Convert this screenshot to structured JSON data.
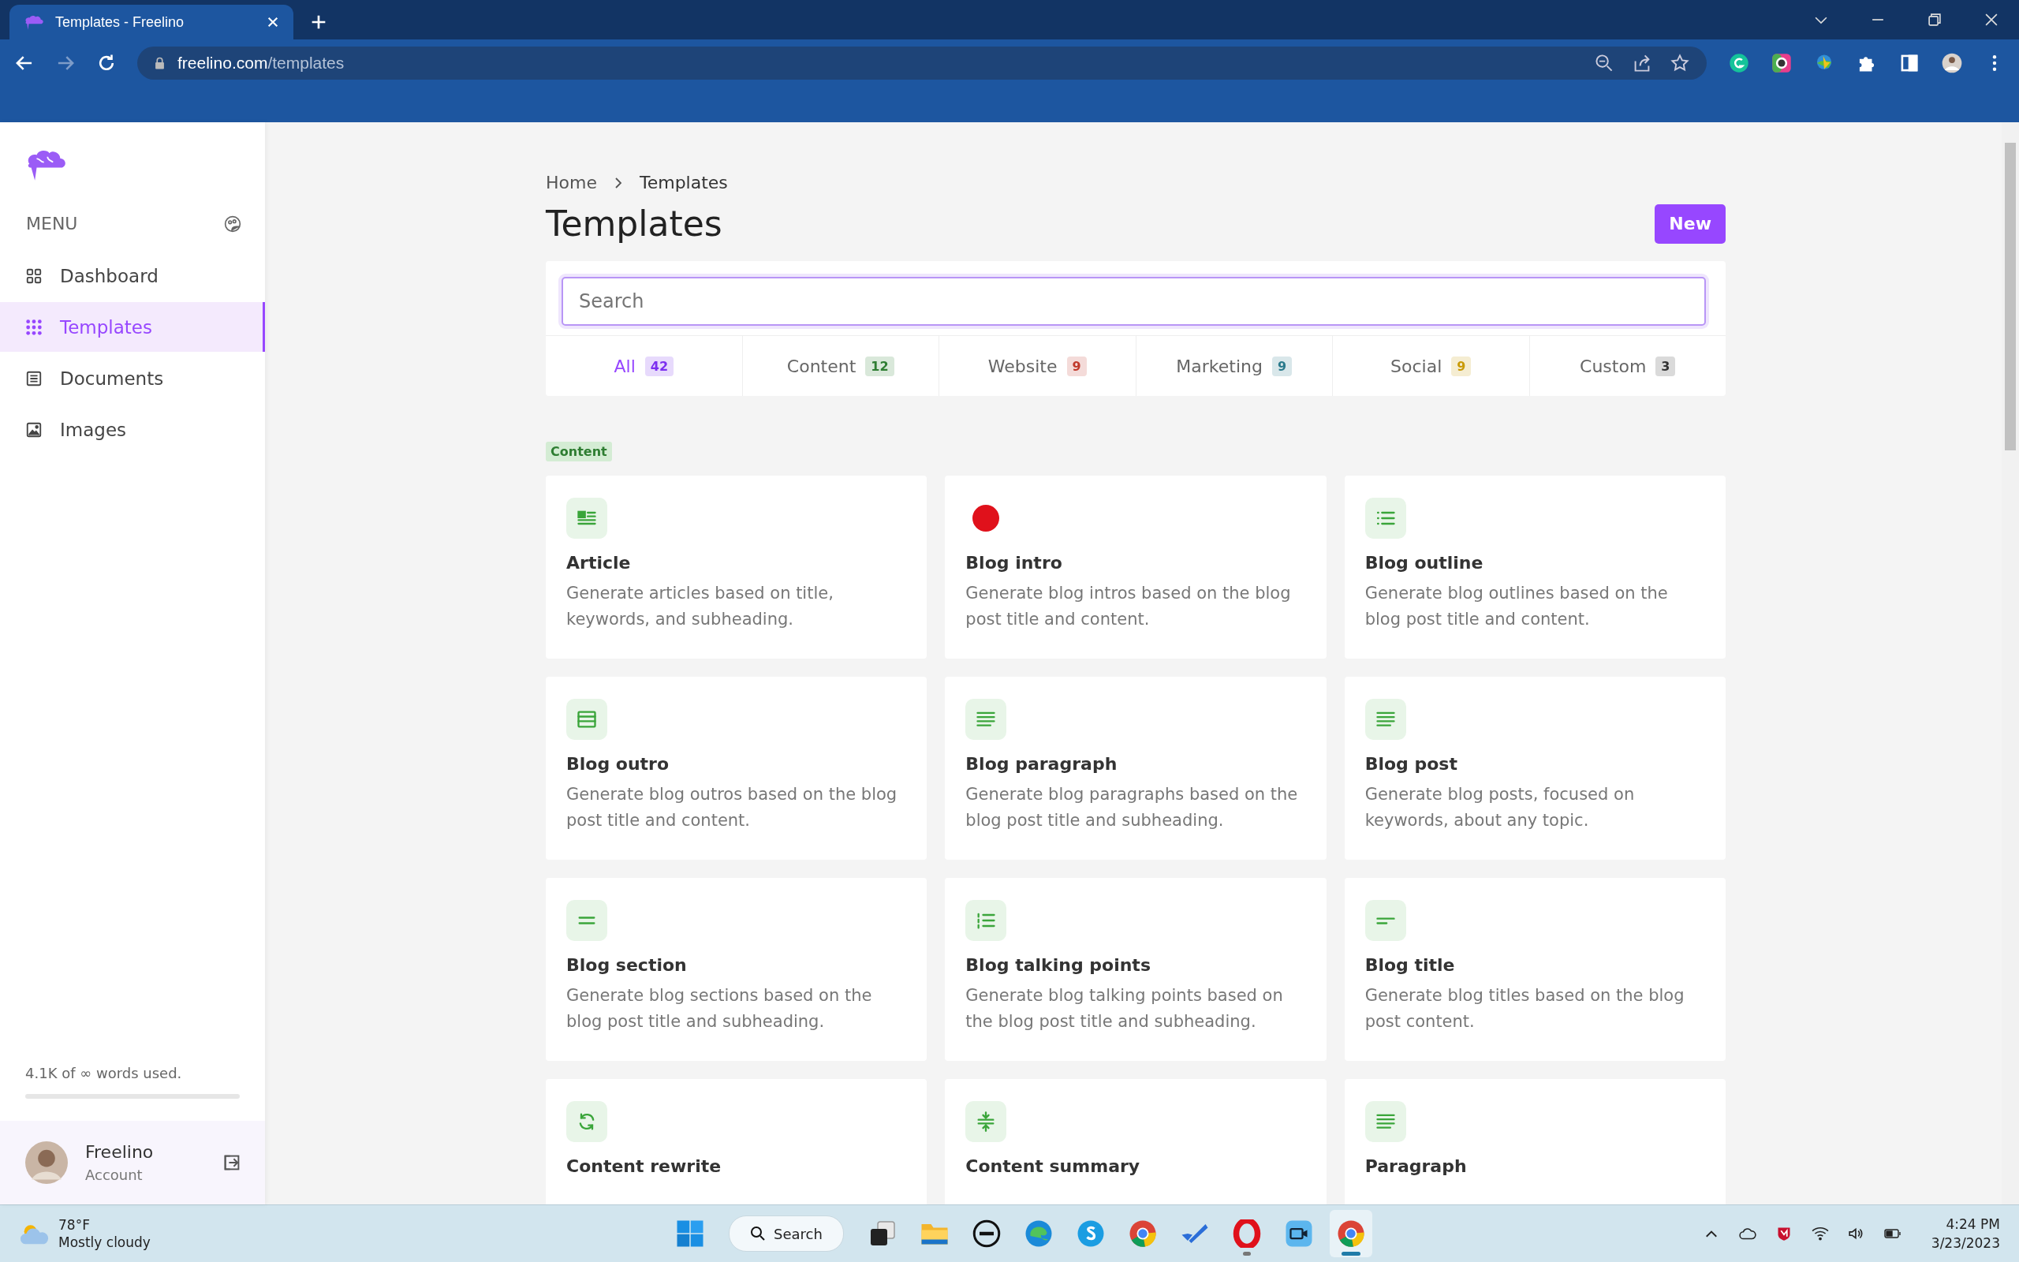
{
  "browser": {
    "tab_title": "Templates - Freelino",
    "url_domain": "freelino.com",
    "url_path": "/templates"
  },
  "sidebar": {
    "menu_label": "MENU",
    "items": [
      {
        "label": "Dashboard",
        "kind": "grid",
        "selected": false
      },
      {
        "label": "Templates",
        "kind": "dots",
        "selected": true
      },
      {
        "label": "Documents",
        "kind": "document",
        "selected": false
      },
      {
        "label": "Images",
        "kind": "image",
        "selected": false
      }
    ],
    "usage": {
      "text": "4.1K of ∞ words used."
    },
    "user": {
      "name": "Freelino",
      "subtitle": "Account"
    }
  },
  "breadcrumb": [
    "Home",
    "Templates"
  ],
  "title": "Templates",
  "new_button": "New",
  "search": {
    "placeholder": "Search"
  },
  "filters": [
    {
      "label": "All",
      "count": "42",
      "selected": true,
      "color": "#7c2ff0"
    },
    {
      "label": "Content",
      "count": "12",
      "selected": false,
      "color": "#2e7d32"
    },
    {
      "label": "Website",
      "count": "9",
      "selected": false,
      "color": "#c0392b"
    },
    {
      "label": "Marketing",
      "count": "9",
      "selected": false,
      "color": "#2a7a8c"
    },
    {
      "label": "Social",
      "count": "9",
      "selected": false,
      "color": "#c99a06"
    },
    {
      "label": "Custom",
      "count": "3",
      "selected": false,
      "color": "#333333"
    }
  ],
  "section_label": "Content",
  "cards": [
    {
      "kind": "article",
      "title": "Article",
      "description": "Generate articles based on title, keywords, and subheading."
    },
    {
      "kind": "dot",
      "title": "Blog intro",
      "description": "Generate blog intros based on the blog post title and content."
    },
    {
      "kind": "list",
      "title": "Blog outline",
      "description": "Generate blog outlines based on the blog post title and content."
    },
    {
      "kind": "boxed-lines",
      "title": "Blog outro",
      "description": "Generate blog outros based on the blog post title and content."
    },
    {
      "kind": "paragraph",
      "title": "Blog paragraph",
      "description": "Generate blog paragraphs based on the blog post title and subheading."
    },
    {
      "kind": "paragraph",
      "title": "Blog post",
      "description": "Generate blog posts, focused on keywords, about any topic."
    },
    {
      "kind": "equal",
      "title": "Blog section",
      "description": "Generate blog sections based on the blog post title and subheading."
    },
    {
      "kind": "numbered-list",
      "title": "Blog talking points",
      "description": "Generate blog talking points based on the blog post title and subheading."
    },
    {
      "kind": "title",
      "title": "Blog title",
      "description": "Generate blog titles based on the blog post content."
    },
    {
      "kind": "refresh",
      "title": "Content rewrite"
    },
    {
      "kind": "compress",
      "title": "Content summary"
    },
    {
      "kind": "paragraph",
      "title": "Paragraph"
    }
  ],
  "taskbar": {
    "weather": {
      "temperature": "78°F",
      "condition": "Mostly cloudy"
    },
    "search": "Search",
    "apps": [
      {
        "kind": "windows",
        "running": false,
        "selected": false
      },
      {
        "kind": "search"
      },
      {
        "kind": "taskview",
        "running": false,
        "selected": false
      },
      {
        "kind": "folder",
        "running": false,
        "selected": false
      },
      {
        "kind": "ring-logo",
        "running": false,
        "selected": false
      },
      {
        "kind": "edge",
        "running": false,
        "selected": false
      },
      {
        "kind": "chat",
        "running": false,
        "selected": false
      },
      {
        "kind": "browser",
        "running": false,
        "selected": false
      },
      {
        "kind": "check",
        "running": false,
        "selected": false
      },
      {
        "kind": "opera",
        "running": true,
        "selected": false
      },
      {
        "kind": "camera",
        "running": false,
        "selected": false
      },
      {
        "kind": "browser",
        "running": true,
        "selected": true
      }
    ],
    "time": "4:24 PM",
    "date": "3/23/2023"
  }
}
